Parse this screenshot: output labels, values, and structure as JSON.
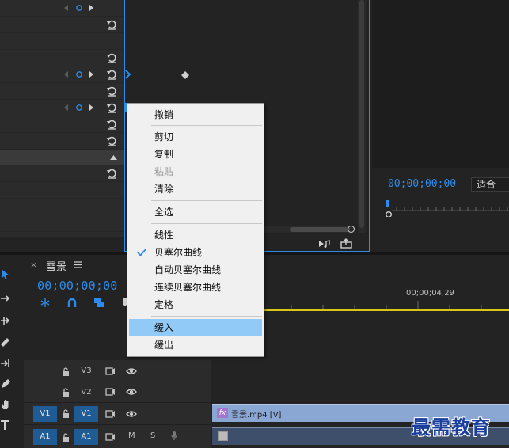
{
  "program_monitor": {
    "timecode": "00;00;00;00",
    "fit_value": "适合"
  },
  "timeline": {
    "sequence_name": "雪景",
    "timecode": "00;00;00;00",
    "ruler_timecode": "00;00;04;29",
    "tracks": {
      "v3": "V3",
      "v2": "V2",
      "v1_source": "V1",
      "v1": "V1",
      "a1_source": "A1",
      "a1": "A1",
      "mute": "M",
      "solo": "S"
    },
    "clip_label": "雪景.mp4 [V]",
    "fx_badge": "fx"
  },
  "context_menu": {
    "items": [
      {
        "label": "撤销"
      },
      {
        "label": "剪切"
      },
      {
        "label": "复制"
      },
      {
        "label": "粘贴"
      },
      {
        "label": "清除"
      },
      {
        "label": "全选"
      },
      {
        "label": "线性"
      },
      {
        "label": "贝塞尔曲线"
      },
      {
        "label": "自动贝塞尔曲线"
      },
      {
        "label": "连续贝塞尔曲线"
      },
      {
        "label": "定格"
      },
      {
        "label": "缓入"
      },
      {
        "label": "缓出"
      }
    ],
    "checked_item": "贝塞尔曲线",
    "highlighted_item": "缓入",
    "disabled_item": "粘贴"
  },
  "watermark": "最需教育",
  "colors": {
    "accent_blue": "#2d8ceb",
    "menu_highlight": "#91c9f7",
    "work_area_yellow": "#d7c51a",
    "watermark_blue": "#1a3f9e"
  }
}
